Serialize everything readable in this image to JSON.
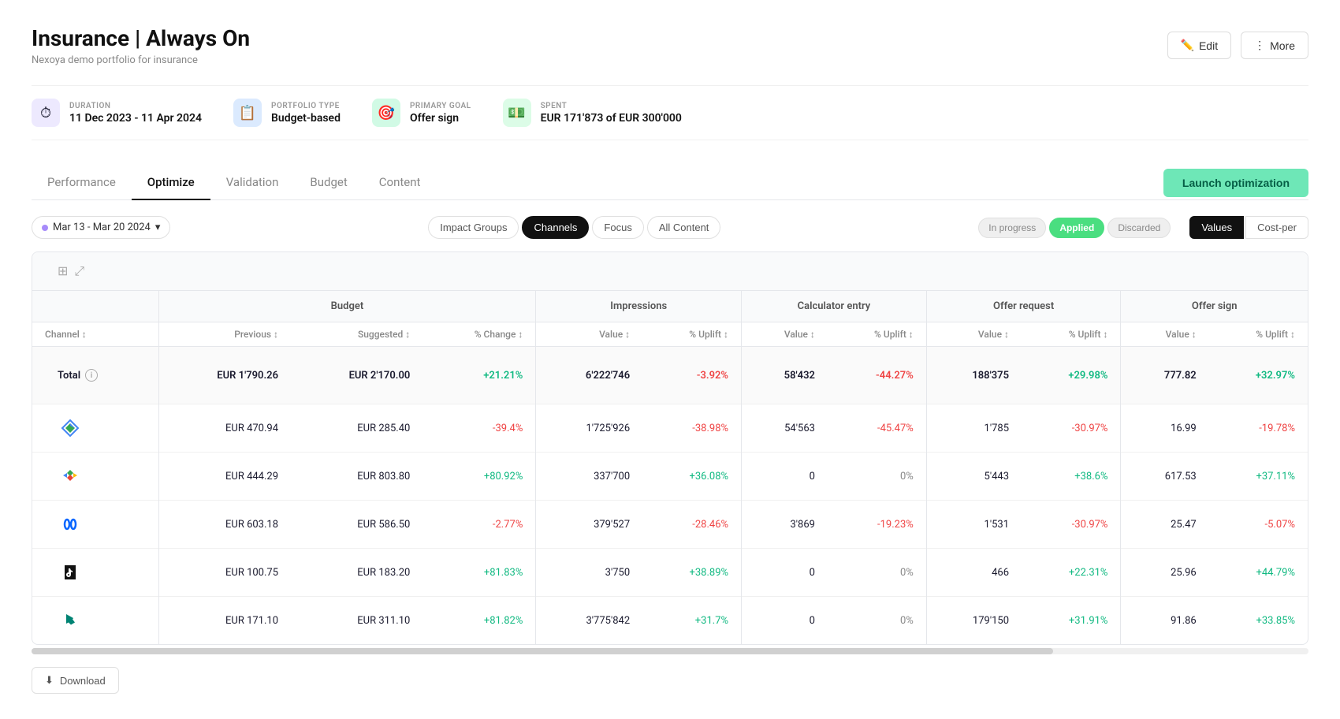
{
  "page": {
    "title": "Insurance | Always On",
    "subtitle": "Nexoya demo portfolio for insurance"
  },
  "header": {
    "edit_label": "Edit",
    "more_label": "More"
  },
  "meta": {
    "duration": {
      "label": "DURATION",
      "value": "11 Dec 2023 - 11 Apr 2024"
    },
    "portfolio_type": {
      "label": "PORTFOLIO TYPE",
      "value": "Budget-based"
    },
    "primary_goal": {
      "label": "PRIMARY GOAL",
      "value": "Offer sign"
    },
    "spent": {
      "label": "SPENT",
      "value": "EUR 171'873 of EUR 300'000"
    }
  },
  "tabs": [
    {
      "label": "Performance",
      "active": false
    },
    {
      "label": "Optimize",
      "active": true
    },
    {
      "label": "Validation",
      "active": false
    },
    {
      "label": "Budget",
      "active": false
    },
    {
      "label": "Content",
      "active": false
    }
  ],
  "launch_btn": "Launch optimization",
  "date_range": "Mar 13 - Mar 20 2024",
  "filter_tabs": [
    {
      "label": "Impact Groups",
      "active": false
    },
    {
      "label": "Channels",
      "active": true
    },
    {
      "label": "Focus",
      "active": false
    },
    {
      "label": "All Content",
      "active": false
    }
  ],
  "status_pills": [
    {
      "label": "In progress",
      "active": false
    },
    {
      "label": "Applied",
      "active": true
    },
    {
      "label": "Discarded",
      "active": false
    }
  ],
  "view_toggle": [
    {
      "label": "Values",
      "active": true
    },
    {
      "label": "Cost-per",
      "active": false
    }
  ],
  "table": {
    "col_groups": [
      {
        "label": "",
        "span": 1
      },
      {
        "label": "Budget",
        "span": 3
      },
      {
        "label": "Impressions",
        "span": 2
      },
      {
        "label": "Calculator entry",
        "span": 2
      },
      {
        "label": "Offer request",
        "span": 2
      },
      {
        "label": "Offer sign",
        "span": 2
      }
    ],
    "sub_headers": [
      "Channel",
      "Previous",
      "Suggested",
      "% Change",
      "Value",
      "% Uplift",
      "Value",
      "% Uplift",
      "Value",
      "% Uplift",
      "Value",
      "% Uplift"
    ],
    "total": {
      "label": "Total",
      "budget_previous": "EUR 1'790.26",
      "budget_suggested": "EUR 2'170.00",
      "budget_change": "+21.21%",
      "impressions_value": "6'222'746",
      "impressions_uplift": "-3.92%",
      "calc_value": "58'432",
      "calc_uplift": "-44.27%",
      "offer_req_value": "188'375",
      "offer_req_uplift": "+29.98%",
      "offer_sign_value": "777.82",
      "offer_sign_uplift": "+32.97%"
    },
    "rows": [
      {
        "channel": "DV360",
        "channel_type": "dv360",
        "budget_previous": "EUR 470.94",
        "budget_suggested": "EUR 285.40",
        "budget_change": "-39.4%",
        "budget_change_type": "negative",
        "impressions_value": "1'725'926",
        "impressions_uplift": "-38.98%",
        "impressions_uplift_type": "negative",
        "calc_value": "54'563",
        "calc_uplift": "-45.47%",
        "calc_uplift_type": "negative",
        "offer_req_value": "1'785",
        "offer_req_uplift": "-30.97%",
        "offer_req_uplift_type": "negative",
        "offer_sign_value": "16.99",
        "offer_sign_uplift": "-19.78%",
        "offer_sign_uplift_type": "negative"
      },
      {
        "channel": "Google Ads",
        "channel_type": "google",
        "budget_previous": "EUR 444.29",
        "budget_suggested": "EUR 803.80",
        "budget_change": "+80.92%",
        "budget_change_type": "positive",
        "impressions_value": "337'700",
        "impressions_uplift": "+36.08%",
        "impressions_uplift_type": "positive",
        "calc_value": "0",
        "calc_uplift": "0%",
        "calc_uplift_type": "neutral",
        "offer_req_value": "5'443",
        "offer_req_uplift": "+38.6%",
        "offer_req_uplift_type": "positive",
        "offer_sign_value": "617.53",
        "offer_sign_uplift": "+37.11%",
        "offer_sign_uplift_type": "positive"
      },
      {
        "channel": "Meta",
        "channel_type": "meta",
        "budget_previous": "EUR 603.18",
        "budget_suggested": "EUR 586.50",
        "budget_change": "-2.77%",
        "budget_change_type": "negative",
        "impressions_value": "379'527",
        "impressions_uplift": "-28.46%",
        "impressions_uplift_type": "negative",
        "calc_value": "3'869",
        "calc_uplift": "-19.23%",
        "calc_uplift_type": "negative",
        "offer_req_value": "1'531",
        "offer_req_uplift": "-30.97%",
        "offer_req_uplift_type": "negative",
        "offer_sign_value": "25.47",
        "offer_sign_uplift": "-5.07%",
        "offer_sign_uplift_type": "negative"
      },
      {
        "channel": "TikTok",
        "channel_type": "tiktok",
        "budget_previous": "EUR 100.75",
        "budget_suggested": "EUR 183.20",
        "budget_change": "+81.83%",
        "budget_change_type": "positive",
        "impressions_value": "3'750",
        "impressions_uplift": "+38.89%",
        "impressions_uplift_type": "positive",
        "calc_value": "0",
        "calc_uplift": "0%",
        "calc_uplift_type": "neutral",
        "offer_req_value": "466",
        "offer_req_uplift": "+22.31%",
        "offer_req_uplift_type": "positive",
        "offer_sign_value": "25.96",
        "offer_sign_uplift": "+44.79%",
        "offer_sign_uplift_type": "positive"
      },
      {
        "channel": "Bing",
        "channel_type": "bing",
        "budget_previous": "EUR 171.10",
        "budget_suggested": "EUR 311.10",
        "budget_change": "+81.82%",
        "budget_change_type": "positive",
        "impressions_value": "3'775'842",
        "impressions_uplift": "+31.7%",
        "impressions_uplift_type": "positive",
        "calc_value": "0",
        "calc_uplift": "0%",
        "calc_uplift_type": "neutral",
        "offer_req_value": "179'150",
        "offer_req_uplift": "+31.91%",
        "offer_req_uplift_type": "positive",
        "offer_sign_value": "91.86",
        "offer_sign_uplift": "+33.85%",
        "offer_sign_uplift_type": "positive"
      }
    ]
  },
  "download_label": "Download"
}
